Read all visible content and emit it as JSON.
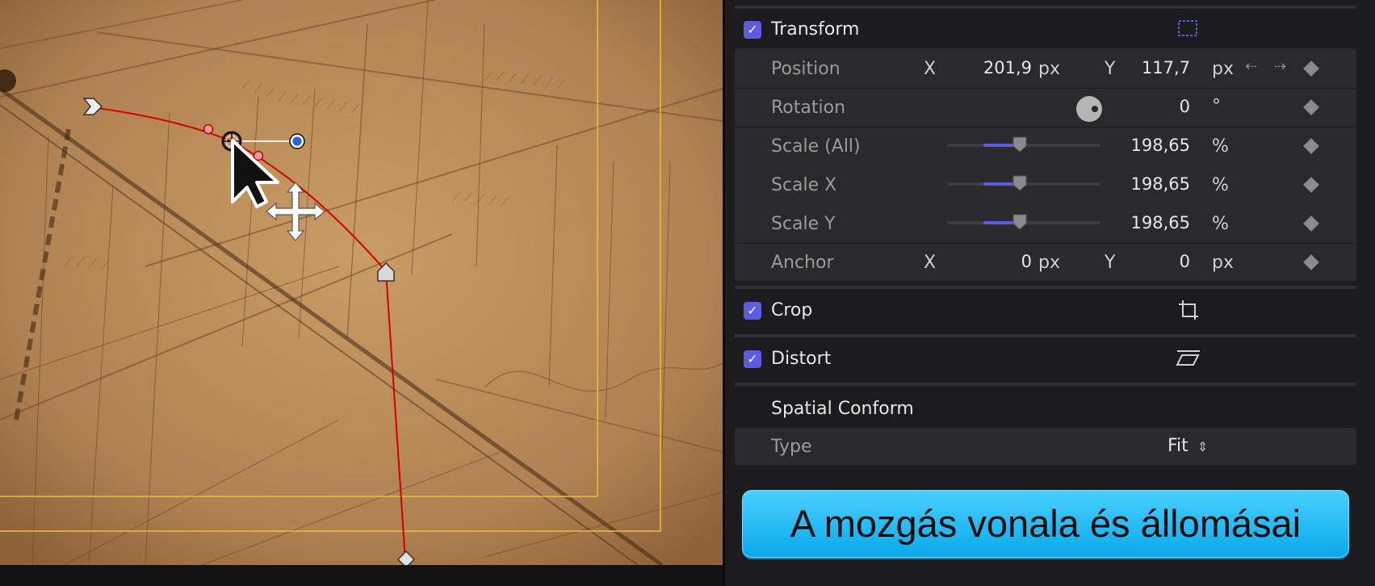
{
  "inspector": {
    "transform": {
      "title": "Transform",
      "checked": true,
      "position": {
        "label": "Position",
        "x_axis": "X",
        "x_value": "201,9",
        "x_unit": "px",
        "y_axis": "Y",
        "y_value": "117,7",
        "y_unit": "px"
      },
      "rotation": {
        "label": "Rotation",
        "value": "0",
        "unit": "°"
      },
      "scale_all": {
        "label": "Scale (All)",
        "value": "198,65",
        "unit": "%"
      },
      "scale_x": {
        "label": "Scale X",
        "value": "198,65",
        "unit": "%"
      },
      "scale_y": {
        "label": "Scale Y",
        "value": "198,65",
        "unit": "%"
      },
      "anchor": {
        "label": "Anchor",
        "x_axis": "X",
        "x_value": "0",
        "x_unit": "px",
        "y_axis": "Y",
        "y_value": "0",
        "y_unit": "px"
      }
    },
    "crop": {
      "title": "Crop",
      "checked": true
    },
    "distort": {
      "title": "Distort",
      "checked": true
    },
    "spatial_conform": {
      "title": "Spatial Conform",
      "type": {
        "label": "Type",
        "value": "Fit"
      }
    }
  },
  "caption_button": {
    "label": "A mozgás vonala és állomásai"
  },
  "colors": {
    "accent": "#5b5ce2",
    "path": "#d40000",
    "guide": "#f0c030",
    "caption_bg": "#1ab4f0"
  }
}
